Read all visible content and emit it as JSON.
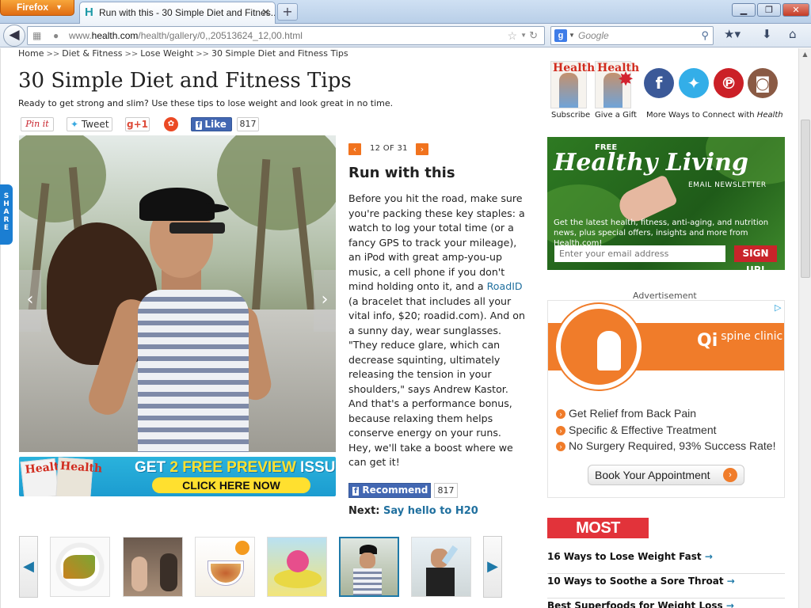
{
  "browser": {
    "app_button": "Firefox",
    "tab_title": "Run with this - 30 Simple Diet and Fitnes...",
    "url_prefix": "www.",
    "url_domain": "health.com",
    "url_path": "/health/gallery/0,,20513624_12,00.html",
    "search_placeholder": "Google",
    "search_engine_letter": "g"
  },
  "breadcrumb": [
    "Home",
    "Diet & Fitness",
    "Lose Weight",
    "30 Simple Diet and Fitness Tips"
  ],
  "breadcrumb_sep": ">>",
  "page": {
    "title": "30 Simple Diet and Fitness Tips",
    "subtitle": "Ready to get strong and slim? Use these tips to lose weight and look great in no time."
  },
  "share": {
    "pin_label": "Pin it",
    "tweet_label": "Tweet",
    "gplus_label": "g+1",
    "like_label": "Like",
    "like_count": "817",
    "side_tab": "SHARE"
  },
  "promo": {
    "mag_name": "Health",
    "headline_pre": "GET ",
    "headline_hl": "2 FREE PREVIEW",
    "headline_post": " ISSUES!",
    "cta": "CLICK HERE NOW"
  },
  "slide": {
    "counter": "12 OF 31",
    "title": "Run with this",
    "body_before_link": "Before you hit the road, make sure you're packing these key staples: a watch to log your total time (or a fancy GPS to track your mileage), an iPod with great amp-you-up music, a cell phone if you don't mind holding onto it, and a ",
    "body_link": "RoadID",
    "body_after_link": " (a bracelet that includes all your vital info, $20; roadid.com). And on a sunny day, wear sunglasses. \"They reduce glare, which can decrease squinting, ultimately releasing the tension in your shoulders,\" says Andrew Kastor. And that's a performance bonus, because relaxing them helps conserve energy on your runs. Hey, we'll take a boost where we can get it!",
    "recommend_label": "Recommend",
    "recommend_count": "817",
    "next_label": "Next:",
    "next_link": "Say hello to H20"
  },
  "right": {
    "mag_name": "Health",
    "subscribe_label": "Subscribe",
    "gift_label": "Give a Gift",
    "connect_label": "More Ways to Connect with ",
    "connect_brand": "Health"
  },
  "newsletter": {
    "free": "FREE",
    "title": "Healthy Living",
    "sub": "EMAIL NEWSLETTER",
    "desc": "Get the latest health, fitness, anti-aging, and nutrition news, plus special offers, insights and more from Health.com!",
    "email_placeholder": "Enter your email address",
    "signup": "SIGN UP!"
  },
  "ad": {
    "label": "Advertisement",
    "brand_q": "Qi",
    "brand_text": "spine clinic",
    "bullets": [
      "Get Relief from Back Pain",
      "Specific & Effective Treatment",
      "No Surgery Required, 93% Success Rate!"
    ],
    "cta": "Book Your Appointment"
  },
  "most_popular": {
    "heading": "MOST POPULAR",
    "items": [
      "16 Ways to Lose Weight Fast",
      "10 Ways to Soothe a Sore Throat",
      "Best Superfoods for Weight Loss"
    ]
  },
  "colors": {
    "accent_orange": "#f1731e",
    "link_blue": "#20709f",
    "facebook_blue": "#4267b2",
    "popular_red": "#e2333a"
  }
}
